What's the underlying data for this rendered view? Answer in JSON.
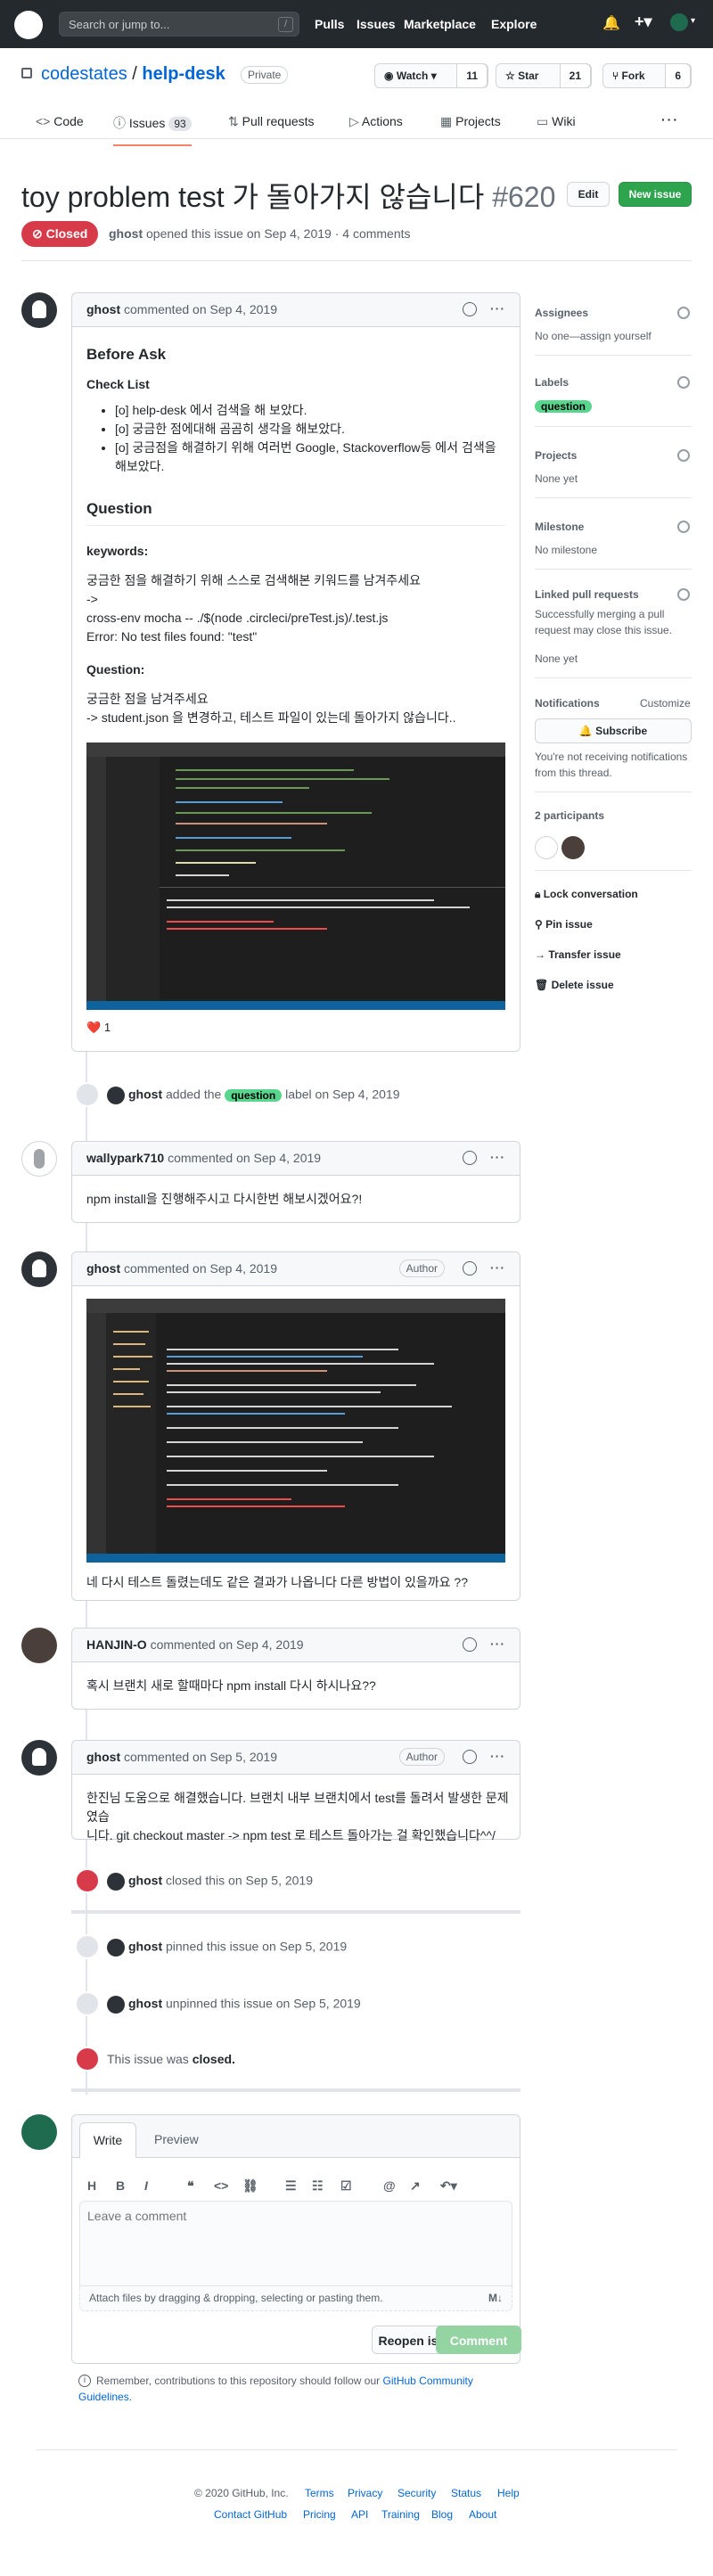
{
  "header": {
    "search_placeholder": "Search or jump to...",
    "slash": "/",
    "nav": [
      "Pulls",
      "Issues",
      "Marketplace",
      "Explore"
    ]
  },
  "repo": {
    "owner": "codestates",
    "name": "help-desk",
    "visibility": "Private",
    "watch_label": "Watch",
    "watch_count": "11",
    "star_label": "Star",
    "star_count": "21",
    "fork_label": "Fork",
    "fork_count": "6"
  },
  "tabs": {
    "code": "Code",
    "issues": "Issues",
    "issues_count": "93",
    "pulls": "Pull requests",
    "actions": "Actions",
    "projects": "Projects",
    "wiki": "Wiki"
  },
  "issue": {
    "title": "toy problem test 가 돌아가지 않습니다",
    "number": "#620",
    "state": "Closed",
    "author": "ghost",
    "meta": "opened this issue on Sep 4, 2019 · 4 comments",
    "edit": "Edit",
    "new_issue": "New issue"
  },
  "comment1": {
    "author": "ghost",
    "action": "commented on Sep 4, 2019",
    "h_before": "Before Ask",
    "h_check": "Check List",
    "check1": "[o] help-desk 에서 검색을 해 보았다.",
    "check2": "[o] 궁금한 점에대해 곰곰히 생각을 해보았다.",
    "check3": "[o] 궁금점을 해결하기 위해 여러번 Google, Stackoverflow등 에서 검색을 해보았다.",
    "h_question": "Question",
    "h_keywords": "keywords:",
    "kw1": "궁금한 점을 해결하기 위해 스스로 검색해본 키워드를 남겨주세요",
    "kw2": "->",
    "kw3": "cross-env mocha -- ./$(node .circleci/preTest.js)/.test.js",
    "kw4": "Error: No test files found: \"test\"",
    "h_question2": "Question:",
    "q1": "궁금한 점을 남겨주세요",
    "q2": "-> student.json 을 변경하고, 테스트 파일이 있는데 돌아가지 않습니다..",
    "reaction": "❤️",
    "reaction_count": "1"
  },
  "label_event": {
    "actor": "ghost",
    "before": "added the",
    "label": "question",
    "after": "label on Sep 4, 2019"
  },
  "comment2": {
    "author": "wallypark710",
    "action": "commented on Sep 4, 2019",
    "body": "npm install을 진행해주시고 다시한번 해보시겠어요?!"
  },
  "comment3": {
    "author": "ghost",
    "action": "commented on Sep 4, 2019",
    "badge": "Author",
    "body": "네 다시 테스트 돌렸는데도 같은 결과가 나옵니다 다른 방법이 있을까요 ??"
  },
  "comment4": {
    "author": "HANJIN-O",
    "action": "commented on Sep 4, 2019",
    "body": "혹시 브랜치 새로 할때마다 npm install 다시 하시나요??"
  },
  "comment5": {
    "author": "ghost",
    "action": "commented on Sep 5, 2019",
    "badge": "Author",
    "body1": "한진님 도움으로 해결했습니다. 브랜치 내부 브랜치에서 test를 돌려서 발생한 문제였습",
    "body2": "니다. git checkout master -> npm test 로 테스트 돌아가는 걸 확인했습니다^^/"
  },
  "events": {
    "closed_actor": "ghost",
    "closed_text": "closed this on Sep 5, 2019",
    "pinned_actor": "ghost",
    "pinned_text": "pinned this issue on Sep 5, 2019",
    "unpinned_actor": "ghost",
    "unpinned_text": "unpinned this issue on Sep 5, 2019",
    "was_closed": "This issue was",
    "closed_word": "closed."
  },
  "editor": {
    "write": "Write",
    "preview": "Preview",
    "placeholder": "Leave a comment",
    "attach": "Attach files by dragging & dropping, selecting or pasting them.",
    "reopen": "Reopen issue",
    "comment": "Comment",
    "remember1": "Remember, contributions to this repository should follow our",
    "guidelines1": "GitHub Community",
    "guidelines2": "Guidelines."
  },
  "sidebar": {
    "assignees": "Assignees",
    "assignees_val": "No one—assign yourself",
    "labels": "Labels",
    "label_val": "question",
    "projects": "Projects",
    "projects_val": "None yet",
    "milestone": "Milestone",
    "milestone_val": "No milestone",
    "linked": "Linked pull requests",
    "linked_desc1": "Successfully merging a pull",
    "linked_desc2": "request may close this issue.",
    "linked_val": "None yet",
    "notifications": "Notifications",
    "customize": "Customize",
    "subscribe": "Subscribe",
    "notif_desc1": "You're not receiving notifications",
    "notif_desc2": "from this thread.",
    "participants": "2 participants",
    "lock": "Lock conversation",
    "pin": "Pin issue",
    "transfer": "Transfer issue",
    "delete": "Delete issue"
  },
  "footer": {
    "copyright": "© 2020 GitHub, Inc.",
    "links1": [
      "Terms",
      "Privacy",
      "Security",
      "Status",
      "Help"
    ],
    "links2": [
      "Contact GitHub",
      "Pricing",
      "API",
      "Training",
      "Blog",
      "About"
    ]
  },
  "colors": {
    "accent": "#0366d6",
    "closed": "#d73a49",
    "green": "#2ea44f",
    "label": "#58d68d"
  }
}
